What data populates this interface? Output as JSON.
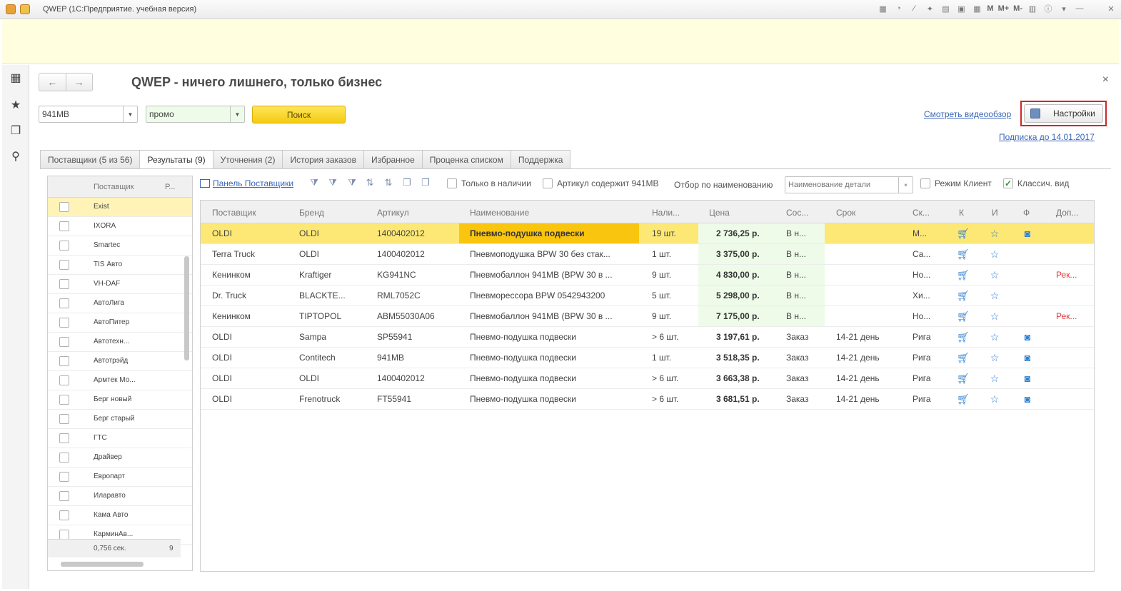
{
  "window": {
    "title": "QWEP  (1С:Предприятие. учебная версия)",
    "tools": [
      "M",
      "M+",
      "M-"
    ]
  },
  "form": {
    "title": "QWEP - ничего лишнего, только бизнес",
    "nav_back": "←",
    "nav_forward": "→",
    "close": "×"
  },
  "search": {
    "article_value": "941MB",
    "mode_value": "промо",
    "search_label": "Поиск"
  },
  "links": {
    "video": "Смотреть видеообзор",
    "subscription": "Подписка до 14.01.2017"
  },
  "settings": {
    "label": "Настройки"
  },
  "tabs": [
    {
      "label": "Поставщики (5 из 56)",
      "active": false
    },
    {
      "label": "Результаты (9)",
      "active": true
    },
    {
      "label": "Уточнения (2)",
      "active": false
    },
    {
      "label": "История заказов",
      "active": false
    },
    {
      "label": "Избранное",
      "active": false
    },
    {
      "label": "Проценка  списком",
      "active": false
    },
    {
      "label": "Поддержка",
      "active": false
    }
  ],
  "suppliers": {
    "header": {
      "name": "Поставщик",
      "col2": "Р..."
    },
    "items": [
      "Exist",
      "IXORA",
      "Smartec",
      "TIS Авто",
      "VH-DAF",
      "АвтоЛига",
      "АвтоПитер",
      "Автотехн...",
      "Автотрэйд",
      "Армтек Мо...",
      "Берг новый",
      "Берг старый",
      "ГТС",
      "Драйвер",
      "Европарт",
      "Иларавто",
      "Кама Авто",
      "КарминАв..."
    ],
    "footer": {
      "time": "0,756 сек.",
      "count": "9"
    }
  },
  "toolbar": {
    "panel_link": "Панель Поставщики",
    "only_in_stock": "Только в наличии",
    "article_contains": "Артикул содержит 941MB",
    "filter_label": "Отбор по наименованию",
    "filter_placeholder": "Наименование детали",
    "client_mode": "Режим Клиент",
    "classic_view": "Классич. вид"
  },
  "results": {
    "columns": [
      "Поставщик",
      "Бренд",
      "Артикул",
      "Наименование",
      "Нали...",
      "Цена",
      "Сос...",
      "Срок",
      "Ск...",
      "К",
      "И",
      "Ф",
      "Доп..."
    ],
    "rows": [
      {
        "supplier": "OLDI",
        "brand": "OLDI",
        "article": "1400402012",
        "name": "Пневмо-подушка подвески",
        "qty": "19 шт.",
        "price": "2 736,25 р.",
        "status": "В н...",
        "term": "",
        "stock": "М...",
        "photo": true,
        "extra": "",
        "selected": true
      },
      {
        "supplier": "Terra Truck",
        "brand": "OLDI",
        "article": "1400402012",
        "name": "Пневмоподушка BPW 30 без стак...",
        "qty": "1 шт.",
        "price": "3 375,00 р.",
        "status": "В н...",
        "term": "",
        "stock": "Са...",
        "photo": false,
        "extra": "",
        "selected": false
      },
      {
        "supplier": "Кенинком",
        "brand": "Kraftiger",
        "article": "KG941NC",
        "name": "Пневмобаллон 941MB (BPW 30 в ...",
        "qty": "9 шт.",
        "price": "4 830,00 р.",
        "status": "В н...",
        "term": "",
        "stock": "Но...",
        "photo": false,
        "extra": "Рек...",
        "selected": false
      },
      {
        "supplier": "Dr. Truck",
        "brand": "BLACKTE...",
        "article": "RML7052C",
        "name": "Пневморессора BPW 0542943200",
        "qty": "5 шт.",
        "price": "5 298,00 р.",
        "status": "В н...",
        "term": "",
        "stock": "Хи...",
        "photo": false,
        "extra": "",
        "selected": false
      },
      {
        "supplier": "Кенинком",
        "brand": "TIPTOPOL",
        "article": "ABM55030A06",
        "name": "Пневмобаллон 941MB (BPW 30 в ...",
        "qty": "9 шт.",
        "price": "7 175,00 р.",
        "status": "В н...",
        "term": "",
        "stock": "Но...",
        "photo": false,
        "extra": "Рек...",
        "selected": false
      },
      {
        "supplier": "OLDI",
        "brand": "Sampa",
        "article": "SP55941",
        "name": "Пневмо-подушка подвески",
        "qty": "> 6 шт.",
        "price": "3 197,61 р.",
        "status": "Заказ",
        "term": "14-21 день",
        "stock": "Рига",
        "photo": true,
        "extra": "",
        "selected": false
      },
      {
        "supplier": "OLDI",
        "brand": "Contitech",
        "article": "941MB",
        "name": "Пневмо-подушка подвески",
        "qty": "1 шт.",
        "price": "3 518,35 р.",
        "status": "Заказ",
        "term": "14-21 день",
        "stock": "Рига",
        "photo": true,
        "extra": "",
        "selected": false
      },
      {
        "supplier": "OLDI",
        "brand": "OLDI",
        "article": "1400402012",
        "name": "Пневмо-подушка подвески",
        "qty": "> 6 шт.",
        "price": "3 663,38 р.",
        "status": "Заказ",
        "term": "14-21 день",
        "stock": "Рига",
        "photo": true,
        "extra": "",
        "selected": false
      },
      {
        "supplier": "OLDI",
        "brand": "Frenotruck",
        "article": "FT55941",
        "name": "Пневмо-подушка подвески",
        "qty": "> 6 шт.",
        "price": "3 681,51 р.",
        "status": "Заказ",
        "term": "14-21 день",
        "stock": "Рига",
        "photo": true,
        "extra": "",
        "selected": false
      }
    ]
  },
  "colors": {
    "accent_yellow": "#f3cb12",
    "selected_row": "#fde875",
    "name_highlight": "#f9c50f",
    "price_bg": "#eefbe9",
    "link_blue": "#3a66b8",
    "highlight_red": "#d02727"
  }
}
